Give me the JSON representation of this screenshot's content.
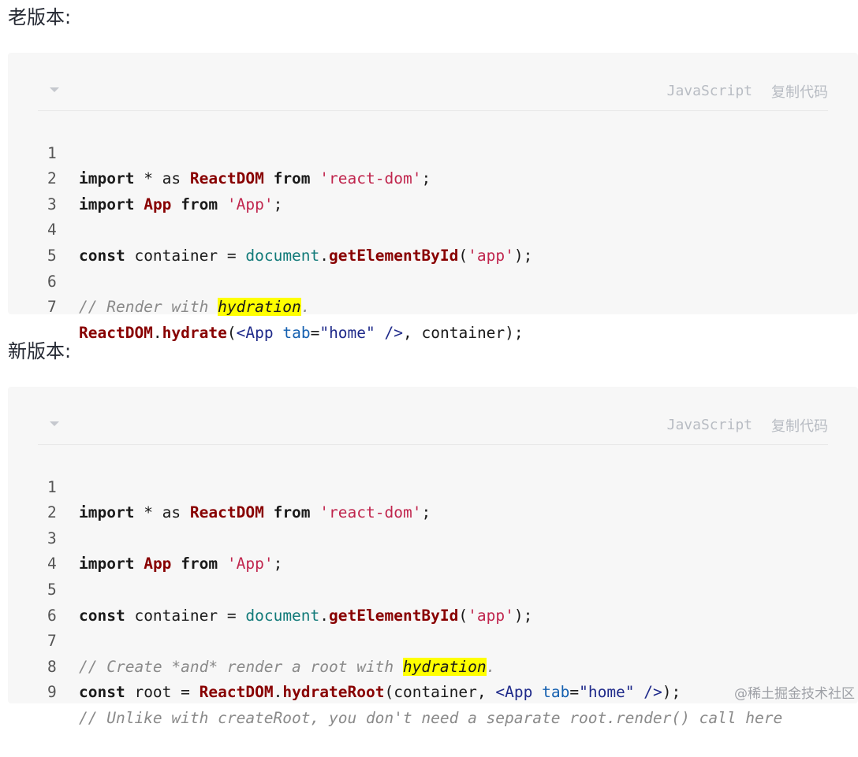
{
  "old": {
    "heading": "老版本:",
    "lang": "JavaScript",
    "copy_label": "复制代码",
    "line_numbers": [
      "1",
      "2",
      "3",
      "4",
      "5",
      "6",
      "7"
    ]
  },
  "new": {
    "heading": "新版本:",
    "lang": "JavaScript",
    "copy_label": "复制代码",
    "line_numbers": [
      "1",
      "2",
      "3",
      "4",
      "5",
      "6",
      "7",
      "8",
      "9"
    ]
  },
  "code_tokens": {
    "import": "import",
    "star_as": " * as ",
    "from": "from",
    "const": "const",
    "reactdom": "ReactDOM",
    "app": "App",
    "react_dom_str": "'react-dom'",
    "app_str": "'App'",
    "app_id_str": "'app'",
    "document": "document",
    "getElementById": "getElementById",
    "container": "container",
    "root": "root",
    "hydrate": "hydrate",
    "hydrateRoot": "hydrateRoot",
    "home_str": "\"home\"",
    "tab_attr": "tab",
    "comment_render_prefix": "// Render with ",
    "comment_create_prefix": "// Create *and* render a root with ",
    "hydration": "hydration",
    "period": ".",
    "comment_unlike": "// Unlike with createRoot, you don't need a separate root.render() call here"
  },
  "watermark": "@稀土掘金技术社区"
}
